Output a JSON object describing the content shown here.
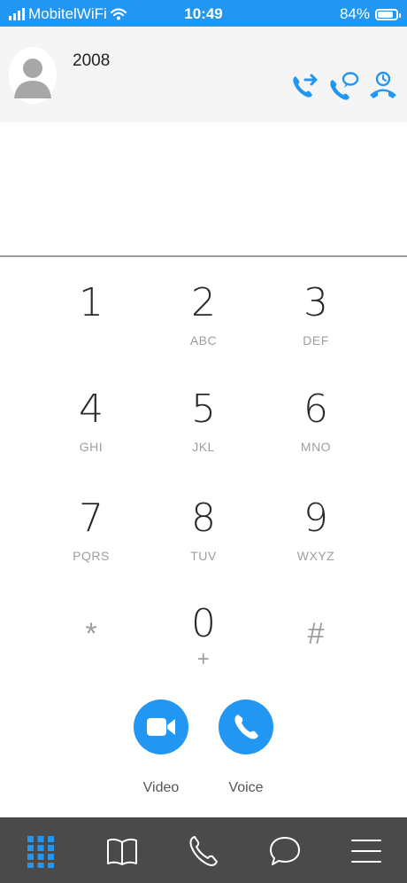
{
  "status_bar": {
    "carrier": "MobitelWiFi",
    "time": "10:49",
    "battery_percent": "84%",
    "battery_level": 0.84
  },
  "contact": {
    "number": "2008",
    "avatar_icon": "person-silhouette-icon"
  },
  "actions": [
    {
      "name": "call-forward-icon"
    },
    {
      "name": "call-message-icon"
    },
    {
      "name": "call-history-icon"
    }
  ],
  "keypad": {
    "keys": [
      {
        "digit": "1",
        "letters": ""
      },
      {
        "digit": "2",
        "letters": "ABC"
      },
      {
        "digit": "3",
        "letters": "DEF"
      },
      {
        "digit": "4",
        "letters": "GHI"
      },
      {
        "digit": "5",
        "letters": "JKL"
      },
      {
        "digit": "6",
        "letters": "MNO"
      },
      {
        "digit": "7",
        "letters": "PQRS"
      },
      {
        "digit": "8",
        "letters": "TUV"
      },
      {
        "digit": "9",
        "letters": "WXYZ"
      }
    ],
    "star": "*",
    "zero": "0",
    "zero_sub": "+",
    "hash": "#"
  },
  "calls": {
    "video_label": "Video",
    "voice_label": "Voice"
  },
  "colors": {
    "accent": "#2196f3",
    "nav_bg": "#4a4a4a"
  },
  "nav": {
    "items": [
      "dialpad-icon",
      "contacts-book-icon",
      "phone-icon",
      "chat-icon",
      "menu-icon"
    ],
    "active": "dialpad-icon"
  }
}
